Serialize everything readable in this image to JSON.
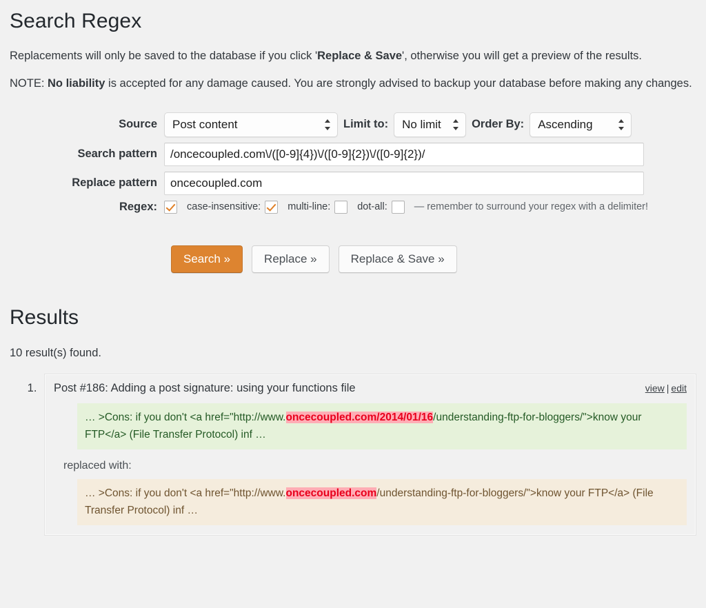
{
  "page": {
    "title": "Search Regex",
    "intro_1_before": "Replacements will only be saved to the database if you click '",
    "intro_1_bold": "Replace & Save",
    "intro_1_after": "', otherwise you will get a preview of the results.",
    "intro_2_before": "NOTE: ",
    "intro_2_bold": "No liability",
    "intro_2_after": " is accepted for any damage caused. You are strongly advised to backup your database before making any changes."
  },
  "form": {
    "source_label": "Source",
    "source_value": "Post content",
    "limit_label": "Limit to:",
    "limit_value": "No limit",
    "order_label": "Order By:",
    "order_value": "Ascending",
    "search_pattern_label": "Search pattern",
    "search_pattern_value": "/oncecoupled.com\\/([0-9]{4})\\/([0-9]{2})\\/([0-9]{2})/",
    "replace_pattern_label": "Replace pattern",
    "replace_pattern_value": "oncecoupled.com",
    "regex_label": "Regex:",
    "case_insensitive_label": "case-insensitive:",
    "multiline_label": "multi-line:",
    "dotall_label": "dot-all:",
    "delimiter_hint": "— remember to surround your regex with a delimiter!"
  },
  "buttons": {
    "search": "Search »",
    "replace": "Replace »",
    "replace_save": "Replace & Save »"
  },
  "results": {
    "heading": "Results",
    "count_text": "10 result(s) found.",
    "item": {
      "title": "Post #186: Adding a post signature: using your functions file",
      "view_link": "view",
      "link_separator": "|",
      "edit_link": "edit",
      "replaced_with_label": "replaced with:",
      "before_prefix": "… >Cons: if you don't <a href=\"http://www.",
      "before_match": "oncecoupled.com/2014/01/16",
      "before_suffix": "/understanding-ftp-for-bloggers/\">know your FTP</a> (File Transfer Protocol) inf …",
      "after_prefix": "… >Cons: if you don't <a href=\"http://www.",
      "after_match": "oncecoupled.com",
      "after_suffix": "/understanding-ftp-for-bloggers/\">know your FTP</a> (File Transfer Protocol) inf …"
    }
  },
  "colors": {
    "page_background": "#f1f1f1",
    "primary_button": "#dd8430",
    "checkbox_check": "#e08027",
    "before_snippet_background": "#e6f2da",
    "after_snippet_background": "#f5ecdd",
    "highlight_background": "#ffadb5",
    "highlight_text": "#e8001c"
  }
}
